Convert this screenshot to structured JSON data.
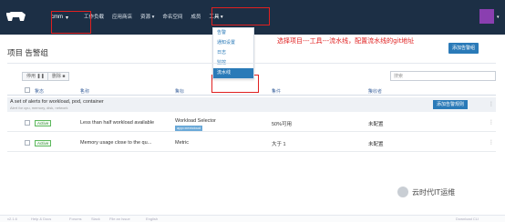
{
  "topbar": {
    "project_name": "cmm",
    "nav_items": [
      "工作负载",
      "应用商店",
      "资源",
      "命名空间",
      "成员",
      "工具"
    ],
    "nav_chevron": "chevron-down-icon",
    "colors": {
      "bg": "#1c2f45",
      "accent": "#2a7ab8"
    }
  },
  "dropdown": {
    "items": [
      "告警",
      "通知设置",
      "日志",
      "监控",
      "流水线"
    ],
    "highlighted_index": 4
  },
  "annotation": "选择项目---工具---流水线，配置流水线的git地址",
  "page": {
    "title": "项目 告警组",
    "add_alert_button": "添加告警组"
  },
  "toolbar": {
    "disable_button": "停用",
    "delete_button": "删除",
    "search_placeholder": "搜索"
  },
  "table": {
    "headers": [
      "状态",
      "名称",
      "目标",
      "条件",
      "接收者"
    ],
    "group": {
      "description": "A set of alerts for workload, pod, container",
      "sub": "Alert for cpu, memory, disk, network",
      "add_rule_button": "添加告警规则"
    },
    "rows": [
      {
        "status": "Active",
        "name": "Less than half workload available",
        "target": "Workload Selector",
        "target_tag": "app=nextcloud",
        "condition": "50%可用",
        "recipient": "未配置"
      },
      {
        "status": "Active",
        "name": "Memory usage close to the qu...",
        "target": "Metric",
        "target_tag": "",
        "condition": "大于 1",
        "recipient": "未配置"
      }
    ]
  },
  "footer": {
    "items": [
      "v2.1.6",
      "Help & Docs",
      "Forums",
      "Slack",
      "File an Issue",
      "English",
      "Download CLI"
    ]
  },
  "watermark": "云时代IT运维"
}
